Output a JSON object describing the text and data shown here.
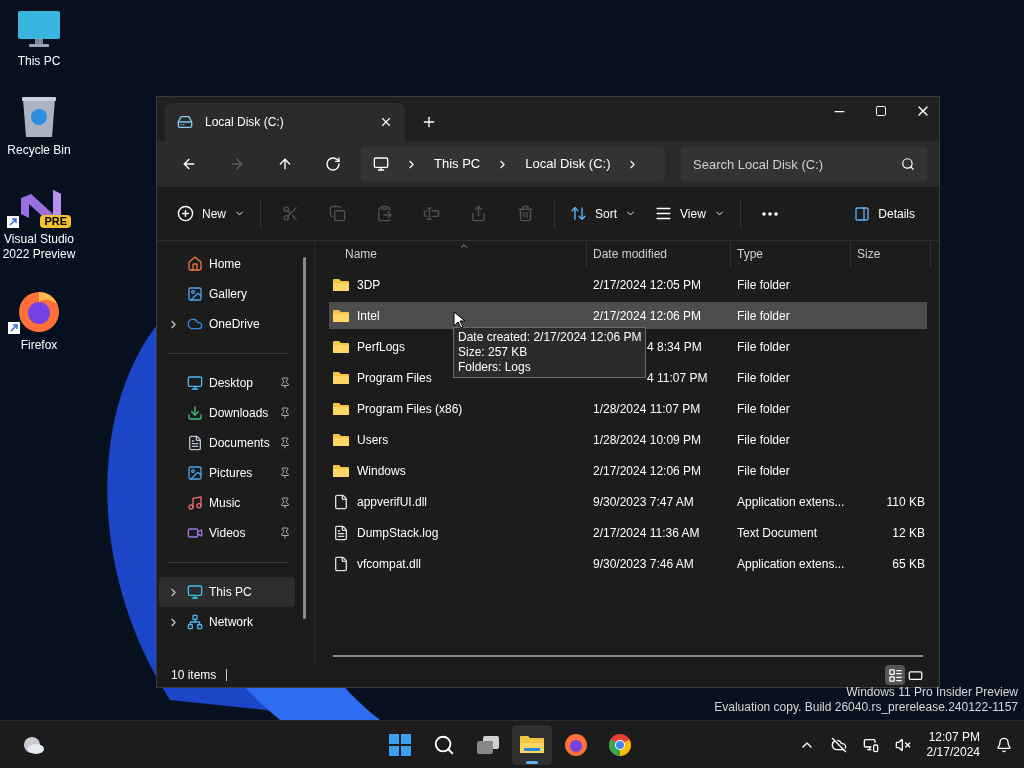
{
  "desktop_icons": [
    {
      "kind": "pc",
      "label": "This PC",
      "shortcut": false
    },
    {
      "kind": "bin",
      "label": "Recycle Bin",
      "shortcut": false
    },
    {
      "kind": "vs",
      "label": "Visual Studio 2022 Preview",
      "badge": "PRE",
      "shortcut": true
    },
    {
      "kind": "firefox",
      "label": "Firefox",
      "shortcut": true
    }
  ],
  "window": {
    "tab": {
      "title": "Local Disk (C:)"
    },
    "nav": [
      {
        "kind": "back",
        "disabled": false
      },
      {
        "kind": "forward",
        "disabled": true
      },
      {
        "kind": "up",
        "disabled": false
      },
      {
        "kind": "refresh",
        "disabled": false
      }
    ],
    "address": {
      "crumbs": [
        "This PC",
        "Local Disk (C:)"
      ]
    },
    "search": {
      "placeholder": "Search Local Disk (C:)"
    },
    "commands": [
      {
        "kind": "new",
        "label": "New",
        "disabled": false
      },
      {
        "kind": "cut",
        "disabled": true
      },
      {
        "kind": "copy",
        "disabled": true
      },
      {
        "kind": "paste",
        "disabled": true
      },
      {
        "kind": "rename",
        "disabled": true
      },
      {
        "kind": "share",
        "disabled": true
      },
      {
        "kind": "delete",
        "disabled": true
      },
      {
        "kind": "sort",
        "label": "Sort",
        "disabled": false
      },
      {
        "kind": "view",
        "label": "View",
        "disabled": false
      },
      {
        "kind": "more",
        "disabled": false
      }
    ],
    "details_button": {
      "label": "Details"
    },
    "sidebar": {
      "groups": [
        [
          {
            "kind": "home",
            "label": "Home",
            "expandable": false,
            "pinned": false,
            "selected": false
          },
          {
            "kind": "gallery",
            "label": "Gallery",
            "expandable": false,
            "pinned": false,
            "selected": false
          },
          {
            "kind": "onedrive",
            "label": "OneDrive",
            "expandable": true,
            "pinned": false,
            "selected": false
          }
        ],
        [
          {
            "kind": "desktop",
            "label": "Desktop",
            "expandable": false,
            "pinned": true,
            "selected": false
          },
          {
            "kind": "downloads",
            "label": "Downloads",
            "expandable": false,
            "pinned": true,
            "selected": false
          },
          {
            "kind": "documents",
            "label": "Documents",
            "expandable": false,
            "pinned": true,
            "selected": false
          },
          {
            "kind": "pictures",
            "label": "Pictures",
            "expandable": false,
            "pinned": true,
            "selected": false
          },
          {
            "kind": "music",
            "label": "Music",
            "expandable": false,
            "pinned": true,
            "selected": false
          },
          {
            "kind": "videos",
            "label": "Videos",
            "expandable": false,
            "pinned": true,
            "selected": false
          }
        ],
        [
          {
            "kind": "pc",
            "label": "This PC",
            "expandable": true,
            "pinned": false,
            "selected": true
          },
          {
            "kind": "network",
            "label": "Network",
            "expandable": true,
            "pinned": false,
            "selected": false
          }
        ]
      ]
    },
    "table": {
      "columns": [
        "Name",
        "Date modified",
        "Type",
        "Size"
      ],
      "rows": [
        {
          "kind": "folder",
          "name": "3DP",
          "date_modified": "2/17/2024 12:05 PM",
          "type": "File folder",
          "selected": false,
          "partly_hidden": false
        },
        {
          "kind": "folder",
          "name": "Intel",
          "date_modified": "2/17/2024 12:06 PM",
          "type": "File folder",
          "selected": true,
          "partly_hidden": false
        },
        {
          "kind": "folder",
          "name": "PerfLogs",
          "date_modified": "4 8:34 PM",
          "type": "File folder",
          "selected": false,
          "partly_hidden": true
        },
        {
          "kind": "folder",
          "name": "Program Files",
          "date_modified": "4 11:07 PM",
          "type": "File folder",
          "selected": false,
          "partly_hidden": true
        },
        {
          "kind": "folder",
          "name": "Program Files (x86)",
          "date_modified": "1/28/2024 11:07 PM",
          "type": "File folder",
          "selected": false,
          "partly_hidden": false
        },
        {
          "kind": "folder",
          "name": "Users",
          "date_modified": "1/28/2024 10:09 PM",
          "type": "File folder",
          "selected": false,
          "partly_hidden": false
        },
        {
          "kind": "folder",
          "name": "Windows",
          "date_modified": "2/17/2024 12:06 PM",
          "type": "File folder",
          "selected": false,
          "partly_hidden": false
        },
        {
          "kind": "dll",
          "name": "appverifUI.dll",
          "date_modified": "9/30/2023 7:47 AM",
          "type": "Application extens...",
          "size": "110 KB",
          "selected": false,
          "partly_hidden": false
        },
        {
          "kind": "text",
          "name": "DumpStack.log",
          "date_modified": "2/17/2024 11:36 AM",
          "type": "Text Document",
          "size": "12 KB",
          "selected": false,
          "partly_hidden": false
        },
        {
          "kind": "dll",
          "name": "vfcompat.dll",
          "date_modified": "9/30/2023 7:46 AM",
          "type": "Application extens...",
          "size": "65 KB",
          "selected": false,
          "partly_hidden": false
        }
      ]
    },
    "tooltip": {
      "lines": [
        "Date created: 2/17/2024 12:06 PM",
        "Size: 257 KB",
        "Folders: Logs"
      ]
    },
    "status_bar": {
      "count": "10 items",
      "layouts": [
        {
          "kind": "details",
          "selected": true
        },
        {
          "kind": "tiles",
          "selected": false
        }
      ]
    }
  },
  "watermark": [
    "Windows 11 Pro Insider Preview",
    "Evaluation copy. Build 26040.rs_prerelease.240122-1157"
  ],
  "taskbar": {
    "apps": [
      {
        "kind": "start",
        "selected": false
      },
      {
        "kind": "search",
        "selected": false
      },
      {
        "kind": "taskview",
        "selected": false
      },
      {
        "kind": "explorer",
        "selected": true
      },
      {
        "kind": "firefox",
        "selected": false
      },
      {
        "kind": "chrome",
        "selected": false
      }
    ],
    "time": "12:07 PM",
    "date": "2/17/2024"
  }
}
